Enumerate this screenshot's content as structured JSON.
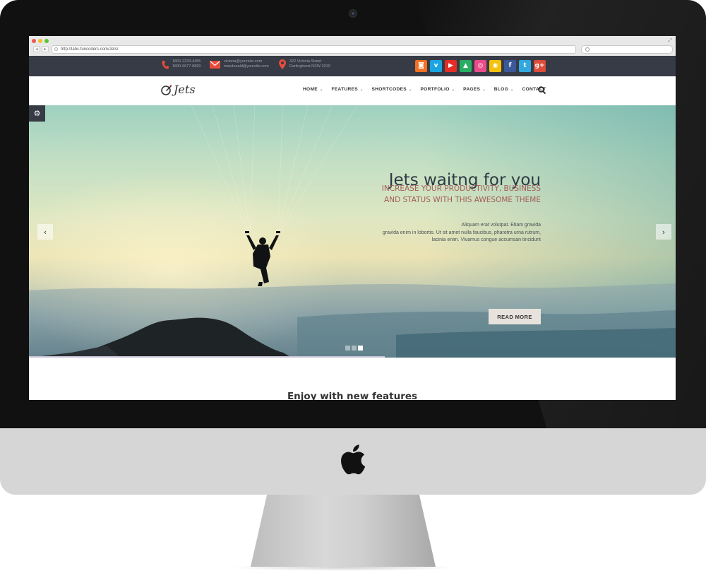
{
  "browser": {
    "url": "http://labs.funcoders.com/Jets/",
    "back": "◂",
    "forward": "▸"
  },
  "contact": {
    "phone_1": "1800-2233-4455",
    "phone_2": "1800-6677-8899",
    "email_1": "victoria@yoursite.com",
    "email_2": "macdonald@yoursite.com",
    "address_1": "322 Victoria Street",
    "address_2": "Darlinghurst NSW 2010"
  },
  "socials": [
    {
      "icon": "rss-icon",
      "glyph": "◙",
      "color": "#f36f21"
    },
    {
      "icon": "vimeo-icon",
      "glyph": "v",
      "color": "#1aa5e0"
    },
    {
      "icon": "youtube-icon",
      "glyph": "▶",
      "color": "#e52d27"
    },
    {
      "icon": "google-drive-icon",
      "glyph": "▲",
      "color": "#27ae60"
    },
    {
      "icon": "dribbble-icon",
      "glyph": "◎",
      "color": "#ea4c89"
    },
    {
      "icon": "github-icon",
      "glyph": "◉",
      "color": "#f4c20d"
    },
    {
      "icon": "facebook-icon",
      "glyph": "f",
      "color": "#3b5998"
    },
    {
      "icon": "twitter-icon",
      "glyph": "t",
      "color": "#31a8df"
    },
    {
      "icon": "googleplus-icon",
      "glyph": "g+",
      "color": "#dd4b39"
    }
  ],
  "logo": {
    "text": "Jets"
  },
  "menu": [
    {
      "label": "HOME",
      "dropdown": true
    },
    {
      "label": "FEATURES",
      "dropdown": true
    },
    {
      "label": "SHORTCODES",
      "dropdown": true
    },
    {
      "label": "PORTFOLIO",
      "dropdown": true
    },
    {
      "label": "PAGES",
      "dropdown": true
    },
    {
      "label": "BLOG",
      "dropdown": true
    },
    {
      "label": "CONTACT",
      "dropdown": false
    }
  ],
  "hero": {
    "title": "Jets waitng for you",
    "subtitle_1": "INCREASE YOUR PRODUCTIVITY, BUSINESS",
    "subtitle_2": "AND STATUS WITH THIS AWESOME THEME",
    "text_1": "Aliquam erat volutpat. Etiam gravida",
    "text_2": "gravida enim in lobortis. Ut sit amet nulla faucibus, pharetra urna rutrum,",
    "text_3": "lacinia enim. Vivamus congue accumsan tincidunt",
    "button": "READ MORE",
    "prev": "‹",
    "next": "›",
    "slides": 3,
    "active_slide": 3,
    "progress": 0.55
  },
  "section": {
    "title": "Enjoy with new features"
  },
  "colors": {
    "top_bar": "#363b45",
    "accent_red": "#e74c3c",
    "subtitle": "#a35c57"
  }
}
